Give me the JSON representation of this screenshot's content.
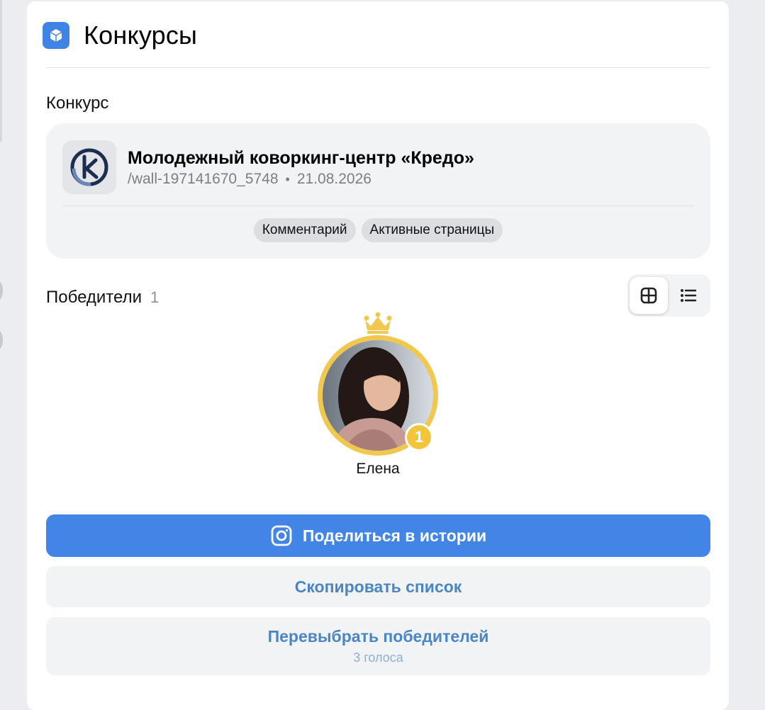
{
  "header": {
    "title": "Конкурсы",
    "icon": "cube-icon"
  },
  "contest": {
    "section_title": "Конкурс",
    "group_name": "Молодежный коворкинг-центр «Кредо»",
    "post_id": "/wall-197141670_5748",
    "separator": "•",
    "date": "21.08.2026",
    "conditions": [
      "Комментарий",
      "Активные страницы"
    ]
  },
  "winners": {
    "title": "Победители",
    "count": "1",
    "view": "grid",
    "list": [
      {
        "name": "Елена",
        "place": "1"
      }
    ]
  },
  "actions": {
    "share": "Поделиться в истории",
    "copy": "Скопировать список",
    "reroll": "Перевыбрать победителей",
    "reroll_sub": "3 голоса"
  },
  "colors": {
    "accent": "#4285e6",
    "gold": "#f0c850",
    "link": "#4a86c7"
  }
}
